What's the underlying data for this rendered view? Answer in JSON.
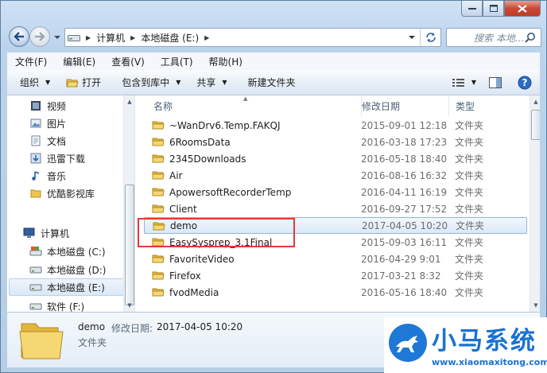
{
  "window": {
    "caption_buttons": [
      "minimize",
      "maximize",
      "close"
    ]
  },
  "address_bar": {
    "segments": [
      "计算机",
      "本地磁盘 (E:)"
    ]
  },
  "search": {
    "placeholder": "搜索 本地..."
  },
  "menu": [
    "文件(F)",
    "编辑(E)",
    "查看(V)",
    "工具(T)",
    "帮助(H)"
  ],
  "toolbar": {
    "organize": "组织",
    "open": "打开",
    "include_library": "包含到库中",
    "share": "共享",
    "new_folder": "新建文件夹"
  },
  "nav_pane": {
    "items": [
      {
        "label": "视频",
        "icon": "video-library-icon"
      },
      {
        "label": "图片",
        "icon": "pictures-library-icon"
      },
      {
        "label": "文档",
        "icon": "documents-library-icon"
      },
      {
        "label": "迅雷下载",
        "icon": "thunder-download-icon"
      },
      {
        "label": "音乐",
        "icon": "music-library-icon"
      },
      {
        "label": "优酷影视库",
        "icon": "folder-icon"
      }
    ],
    "computer_label": "计算机",
    "drives": [
      {
        "label": "本地磁盘 (C:)",
        "selected": false
      },
      {
        "label": "本地磁盘 (D:)",
        "selected": false
      },
      {
        "label": "本地磁盘 (E:)",
        "selected": true
      },
      {
        "label": "软件 (F:)",
        "selected": false
      }
    ]
  },
  "columns": {
    "name": "名称",
    "date": "修改日期",
    "type": "类型"
  },
  "files": [
    {
      "name": "~WanDrv6.Temp.FAKQJ",
      "date": "2015-09-01 12:18",
      "type": "文件夹",
      "selected": false
    },
    {
      "name": "6RoomsData",
      "date": "2016-03-18 17:23",
      "type": "文件夹",
      "selected": false
    },
    {
      "name": "2345Downloads",
      "date": "2016-05-18 18:40",
      "type": "文件夹",
      "selected": false
    },
    {
      "name": "Air",
      "date": "2016-08-16 16:32",
      "type": "文件夹",
      "selected": false
    },
    {
      "name": "ApowersoftRecorderTemp",
      "date": "2016-04-11 16:19",
      "type": "文件夹",
      "selected": false
    },
    {
      "name": "Client",
      "date": "2016-09-27 17:52",
      "type": "文件夹",
      "selected": false
    },
    {
      "name": "demo",
      "date": "2017-04-05 10:20",
      "type": "文件夹",
      "selected": true
    },
    {
      "name": "EasySysprep_3.1Final",
      "date": "2015-09-03 16:11",
      "type": "文件夹",
      "selected": false
    },
    {
      "name": "FavoriteVideo",
      "date": "2016-04-29 9:01",
      "type": "文件夹",
      "selected": false
    },
    {
      "name": "Firefox",
      "date": "2017-03-21 8:32",
      "type": "文件夹",
      "selected": false
    },
    {
      "name": "fvodMedia",
      "date": "2016-05-16 18:40",
      "type": "文件夹",
      "selected": false
    }
  ],
  "details": {
    "name": "demo",
    "date_label": "修改日期:",
    "date_value": "2017-04-05 10:20",
    "type": "文件夹"
  },
  "watermark": {
    "brand": "小马系统",
    "url": "www.xiaomaxitong.com"
  },
  "colors": {
    "highlight_box": "#e23a3a",
    "watermark_blue": "#1a72d0",
    "folder_yellow": "#f0c94a"
  }
}
